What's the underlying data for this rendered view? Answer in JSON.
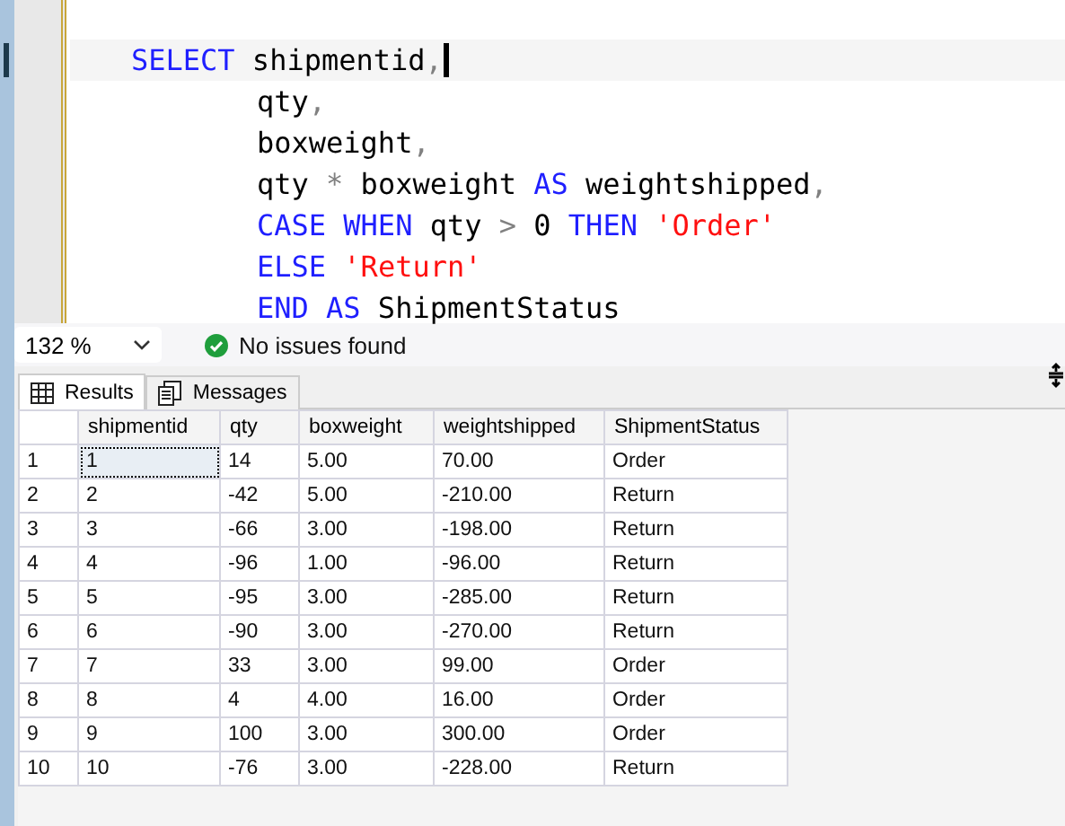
{
  "editor": {
    "lines": [
      {
        "current": true,
        "tokens": [
          {
            "text": "SELECT",
            "kind": "keyword"
          },
          {
            "text": " shipmentid",
            "kind": "ident"
          },
          {
            "text": ",",
            "kind": "punct"
          }
        ]
      },
      {
        "current": false,
        "tokens": [
          {
            "text": "qty",
            "kind": "ident"
          },
          {
            "text": ",",
            "kind": "punct"
          }
        ]
      },
      {
        "current": false,
        "tokens": [
          {
            "text": "boxweight",
            "kind": "ident"
          },
          {
            "text": ",",
            "kind": "punct"
          }
        ]
      },
      {
        "current": false,
        "tokens": [
          {
            "text": "qty ",
            "kind": "ident"
          },
          {
            "text": "*",
            "kind": "operator"
          },
          {
            "text": " boxweight ",
            "kind": "ident"
          },
          {
            "text": "AS",
            "kind": "keyword"
          },
          {
            "text": " weightshipped",
            "kind": "ident"
          },
          {
            "text": ",",
            "kind": "punct"
          }
        ]
      },
      {
        "current": false,
        "tokens": [
          {
            "text": "CASE WHEN",
            "kind": "keyword"
          },
          {
            "text": " qty ",
            "kind": "ident"
          },
          {
            "text": ">",
            "kind": "operator"
          },
          {
            "text": " 0 ",
            "kind": "ident"
          },
          {
            "text": "THEN ",
            "kind": "keyword"
          },
          {
            "text": "'Order'",
            "kind": "string"
          }
        ]
      },
      {
        "current": false,
        "tokens": [
          {
            "text": "ELSE ",
            "kind": "keyword"
          },
          {
            "text": "'Return'",
            "kind": "string"
          }
        ]
      },
      {
        "current": false,
        "tokens": [
          {
            "text": "END AS",
            "kind": "keyword"
          },
          {
            "text": " ShipmentStatus",
            "kind": "ident"
          }
        ]
      }
    ]
  },
  "status_bar": {
    "zoom": "132 %",
    "issues": "No issues found"
  },
  "tabs": [
    {
      "label": "Results",
      "selected": true,
      "kind": "grid"
    },
    {
      "label": "Messages",
      "selected": false,
      "kind": "messages"
    }
  ],
  "table": {
    "columns": [
      "shipmentid",
      "qty",
      "boxweight",
      "weightshipped",
      "ShipmentStatus"
    ],
    "rows": [
      {
        "number": "1",
        "cells": [
          "1",
          "14",
          "5.00",
          "70.00",
          "Order"
        ],
        "selected": true
      },
      {
        "number": "2",
        "cells": [
          "2",
          "-42",
          "5.00",
          "-210.00",
          "Return"
        ],
        "selected": false
      },
      {
        "number": "3",
        "cells": [
          "3",
          "-66",
          "3.00",
          "-198.00",
          "Return"
        ],
        "selected": false
      },
      {
        "number": "4",
        "cells": [
          "4",
          "-96",
          "1.00",
          "-96.00",
          "Return"
        ],
        "selected": false
      },
      {
        "number": "5",
        "cells": [
          "5",
          "-95",
          "3.00",
          "-285.00",
          "Return"
        ],
        "selected": false
      },
      {
        "number": "6",
        "cells": [
          "6",
          "-90",
          "3.00",
          "-270.00",
          "Return"
        ],
        "selected": false
      },
      {
        "number": "7",
        "cells": [
          "7",
          "33",
          "3.00",
          "99.00",
          "Order"
        ],
        "selected": false
      },
      {
        "number": "8",
        "cells": [
          "8",
          "4",
          "4.00",
          "16.00",
          "Order"
        ],
        "selected": false
      },
      {
        "number": "9",
        "cells": [
          "9",
          "100",
          "3.00",
          "300.00",
          "Order"
        ],
        "selected": false
      },
      {
        "number": "10",
        "cells": [
          "10",
          "-76",
          "3.00",
          "-228.00",
          "Return"
        ],
        "selected": false
      }
    ]
  }
}
